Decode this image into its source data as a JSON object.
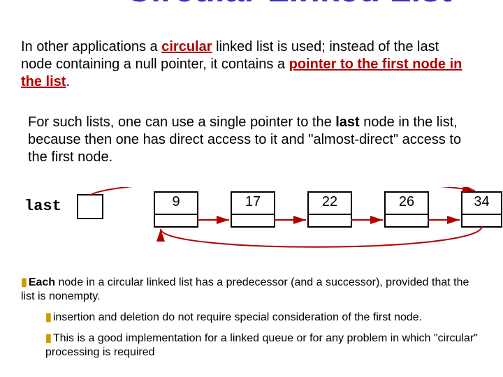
{
  "title": "Circular Linked List",
  "p1": {
    "pre": "In other applications a ",
    "circular": "circular",
    "mid1": " linked list is used; instead of the last node containing a null pointer, it contains a ",
    "ptrphrase": "pointer to the first node in the list",
    "period": "."
  },
  "p2": {
    "pre": "For such lists, one can use a single pointer to the ",
    "last": "last",
    "post": " node in the list, because then one has direct access to it and \"almost-direct\" access to the first node."
  },
  "diagram": {
    "last_label": "last",
    "nodes": [
      "9",
      "17",
      "22",
      "26",
      "34"
    ]
  },
  "bullets": {
    "b1": {
      "each": "Each",
      "rest": " node in a circular linked list has a predecessor (and a successor), provided that the list is nonempty."
    },
    "b2": "insertion and deletion do not require special consideration of the first node.",
    "b3": "This is a good implementation for a linked queue or for any problem in which \"circular\" processing is required"
  }
}
